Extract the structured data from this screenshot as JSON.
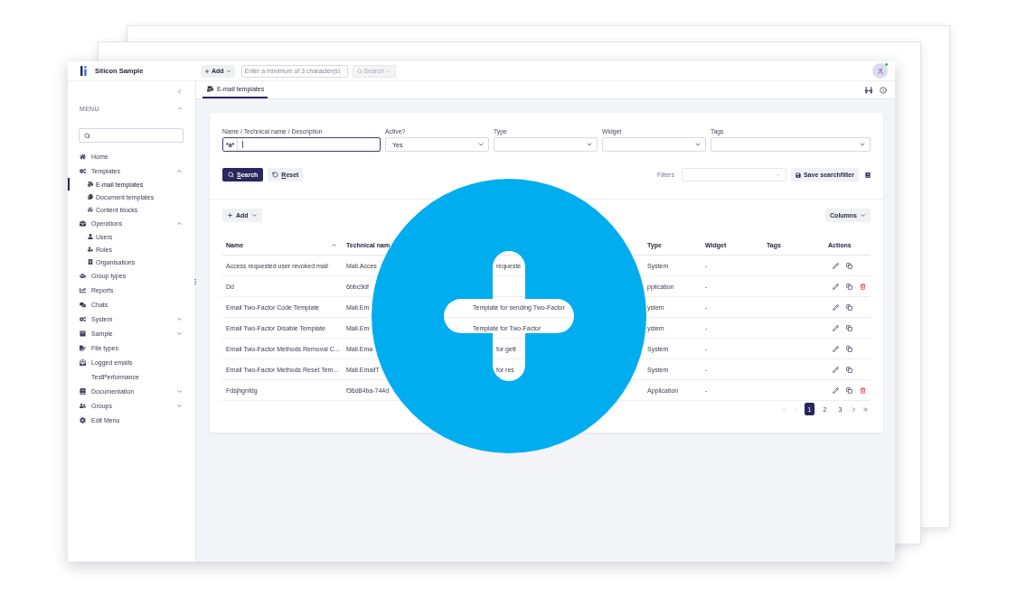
{
  "window": {
    "brand": "Silicon Sample"
  },
  "topbar": {
    "add_button": {
      "label": "Add"
    },
    "quick_search": {
      "placeholder": "Enter a minimum of 3 character(s)"
    },
    "search_button": {
      "label": "Search",
      "disabled": true
    },
    "avatar": {
      "online": true
    }
  },
  "sidebar": {
    "menu_label": "MENU",
    "items": [
      {
        "label": "Home",
        "selected": false
      },
      {
        "label": "Templates",
        "selected": false,
        "expanded": true,
        "children": [
          {
            "label": "E-mail templates",
            "selected": true
          },
          {
            "label": "Document templates",
            "selected": false
          },
          {
            "label": "Content blocks",
            "selected": false
          }
        ]
      },
      {
        "label": "Operations",
        "selected": false,
        "expanded": true,
        "children": [
          {
            "label": "Users",
            "selected": false
          },
          {
            "label": "Roles",
            "selected": false
          },
          {
            "label": "Organisations",
            "selected": false
          }
        ]
      },
      {
        "label": "Group types",
        "selected": false
      },
      {
        "label": "Reports",
        "selected": false
      },
      {
        "label": "Chats",
        "selected": false
      },
      {
        "label": "System",
        "selected": false,
        "expanded": false
      },
      {
        "label": "Sample",
        "selected": false,
        "expanded": false
      },
      {
        "label": "File types",
        "selected": false
      },
      {
        "label": "Logged emails",
        "selected": false
      },
      {
        "label": "TestPerformance",
        "selected": false
      },
      {
        "label": "Documentation",
        "selected": false,
        "expanded": false
      },
      {
        "label": "Groups",
        "selected": false,
        "expanded": false
      },
      {
        "label": "Edit Menu",
        "selected": false
      }
    ]
  },
  "tabs": [
    {
      "label": "E-mail templates",
      "selected": true
    }
  ],
  "filters": {
    "fields": [
      {
        "kind": "text",
        "label": "Name / Technical name / Description",
        "prefix": "*a*",
        "focused": true
      },
      {
        "kind": "select",
        "label": "Active?",
        "value": "Yes"
      },
      {
        "kind": "select",
        "label": "Type"
      },
      {
        "kind": "select",
        "label": "Widget"
      },
      {
        "kind": "select",
        "label": "Tags"
      }
    ],
    "search_button": {
      "label": "Search",
      "first_letter_underlined": true
    },
    "reset_button": {
      "label": "Reset",
      "first_letter_underlined": true
    },
    "saved_filters": {
      "label": "Filters",
      "disabled": true
    },
    "save_button": {
      "label": "Save searchfilter"
    }
  },
  "toolbar": {
    "add_button": {
      "label": "Add"
    },
    "columns_button": {
      "label": "Columns"
    }
  },
  "table": {
    "columns": [
      {
        "label": "Name",
        "sorted_ascending": true
      },
      {
        "label": "Technical nam"
      },
      {
        "label": "Type"
      },
      {
        "label": "Widget"
      },
      {
        "label": "Tags"
      },
      {
        "label": "Actions"
      }
    ],
    "rows": [
      {
        "name": "Access requested user revoked mail",
        "technical_name": "Mail.Acces",
        "column_3": {
          "text": "requeste",
          "cut_left": true
        },
        "type": "System",
        "widget": "-",
        "deletable": false
      },
      {
        "name": "Dd",
        "technical_name": "6bbc9df",
        "type": "pplication",
        "widget": "-",
        "deletable": true
      },
      {
        "name": "Email Two-Factor Code Template",
        "technical_name": "Mail.Em",
        "column_3": {
          "text": "Template for sending Two-Factor",
          "cut_left": false
        },
        "type": "ystem",
        "widget": "-",
        "deletable": false
      },
      {
        "name": "Email Two-Factor Disable Template",
        "technical_name": "Mail.Em",
        "column_3": {
          "text": "Template for Two-Factor",
          "cut_left": false
        },
        "type": "ystem",
        "widget": "-",
        "deletable": false
      },
      {
        "name": "Email Two-Factor Methods Removal C...",
        "technical_name": "Mail.Ema",
        "column_3": {
          "text": "for gett",
          "cut_left": true
        },
        "type": "System",
        "widget": "-",
        "deletable": false
      },
      {
        "name": "Email Two-Factor Methods Reset Tem...",
        "technical_name": "Mail.EmailT",
        "column_3": {
          "text": "for res",
          "cut_left": true
        },
        "type": "System",
        "widget": "-",
        "deletable": false
      },
      {
        "name": "Fdsjhgnfdg",
        "technical_name": "f36d84ba-744d",
        "type": "Application",
        "widget": "-",
        "deletable": true
      }
    ]
  },
  "pagination": {
    "first": {
      "disabled": true
    },
    "previous": {
      "disabled": true
    },
    "pages": [
      {
        "label": "1",
        "selected": true
      },
      {
        "label": "2",
        "selected": false
      },
      {
        "label": "3",
        "selected": false
      }
    ],
    "next": {
      "disabled": false
    },
    "last": {
      "disabled": false
    }
  }
}
